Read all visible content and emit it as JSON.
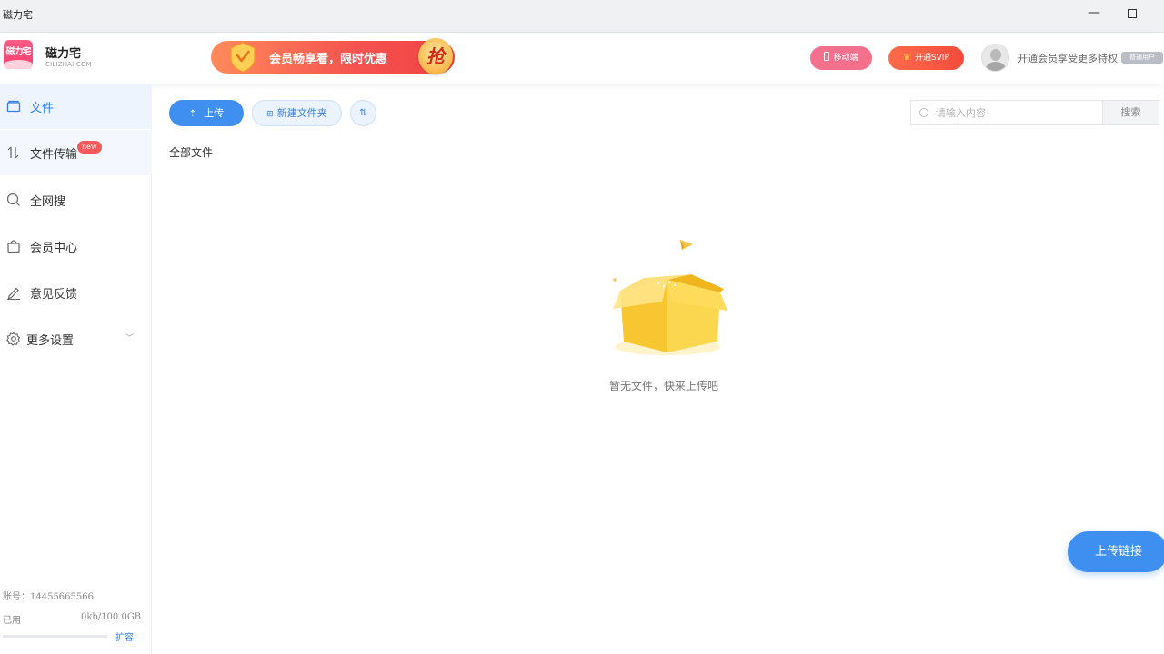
{
  "window": {
    "title": "磁力宅",
    "minimize_glyph": "—"
  },
  "header": {
    "brand_name": "磁力宅",
    "brand_sub": "CILIZHAI.COM",
    "logo_text": "磁力宅",
    "promo_text": "会员畅享看，限时优惠",
    "promo_grab": "抢",
    "mobile_label": "移动端",
    "svip_label": "开通SVIP",
    "vip_hint": "开通会员享受更多特权",
    "user_tag": "普通用户"
  },
  "sidebar": {
    "items": [
      {
        "label": "文件",
        "icon": "folder-icon"
      },
      {
        "label": "文件传输",
        "icon": "transfer-icon",
        "badge": "new"
      },
      {
        "label": "全网搜",
        "icon": "search-icon"
      },
      {
        "label": "会员中心",
        "icon": "bag-icon"
      },
      {
        "label": "意见反馈",
        "icon": "pen-icon"
      },
      {
        "label": "更多设置",
        "icon": "gear-icon"
      }
    ],
    "account": "账号：14455665566",
    "used_label": "已用",
    "used_value": "0kb/100.0GB",
    "usage_fraction": 0,
    "expand_label": "扩容"
  },
  "toolbar": {
    "upload_label": "上传",
    "new_folder_label": "新建文件夹",
    "search_placeholder": "请输入内容",
    "search_button": "搜索"
  },
  "main": {
    "breadcrumb": "全部文件",
    "empty_text": "暂无文件，快来上传吧",
    "fab_label": "上传链接"
  },
  "colors": {
    "accent": "#3f8ff0",
    "active_nav_bg": "#edf4fe",
    "badge": "#f5595b",
    "svip": "#f34c3c",
    "mobile": "#f5708c"
  }
}
